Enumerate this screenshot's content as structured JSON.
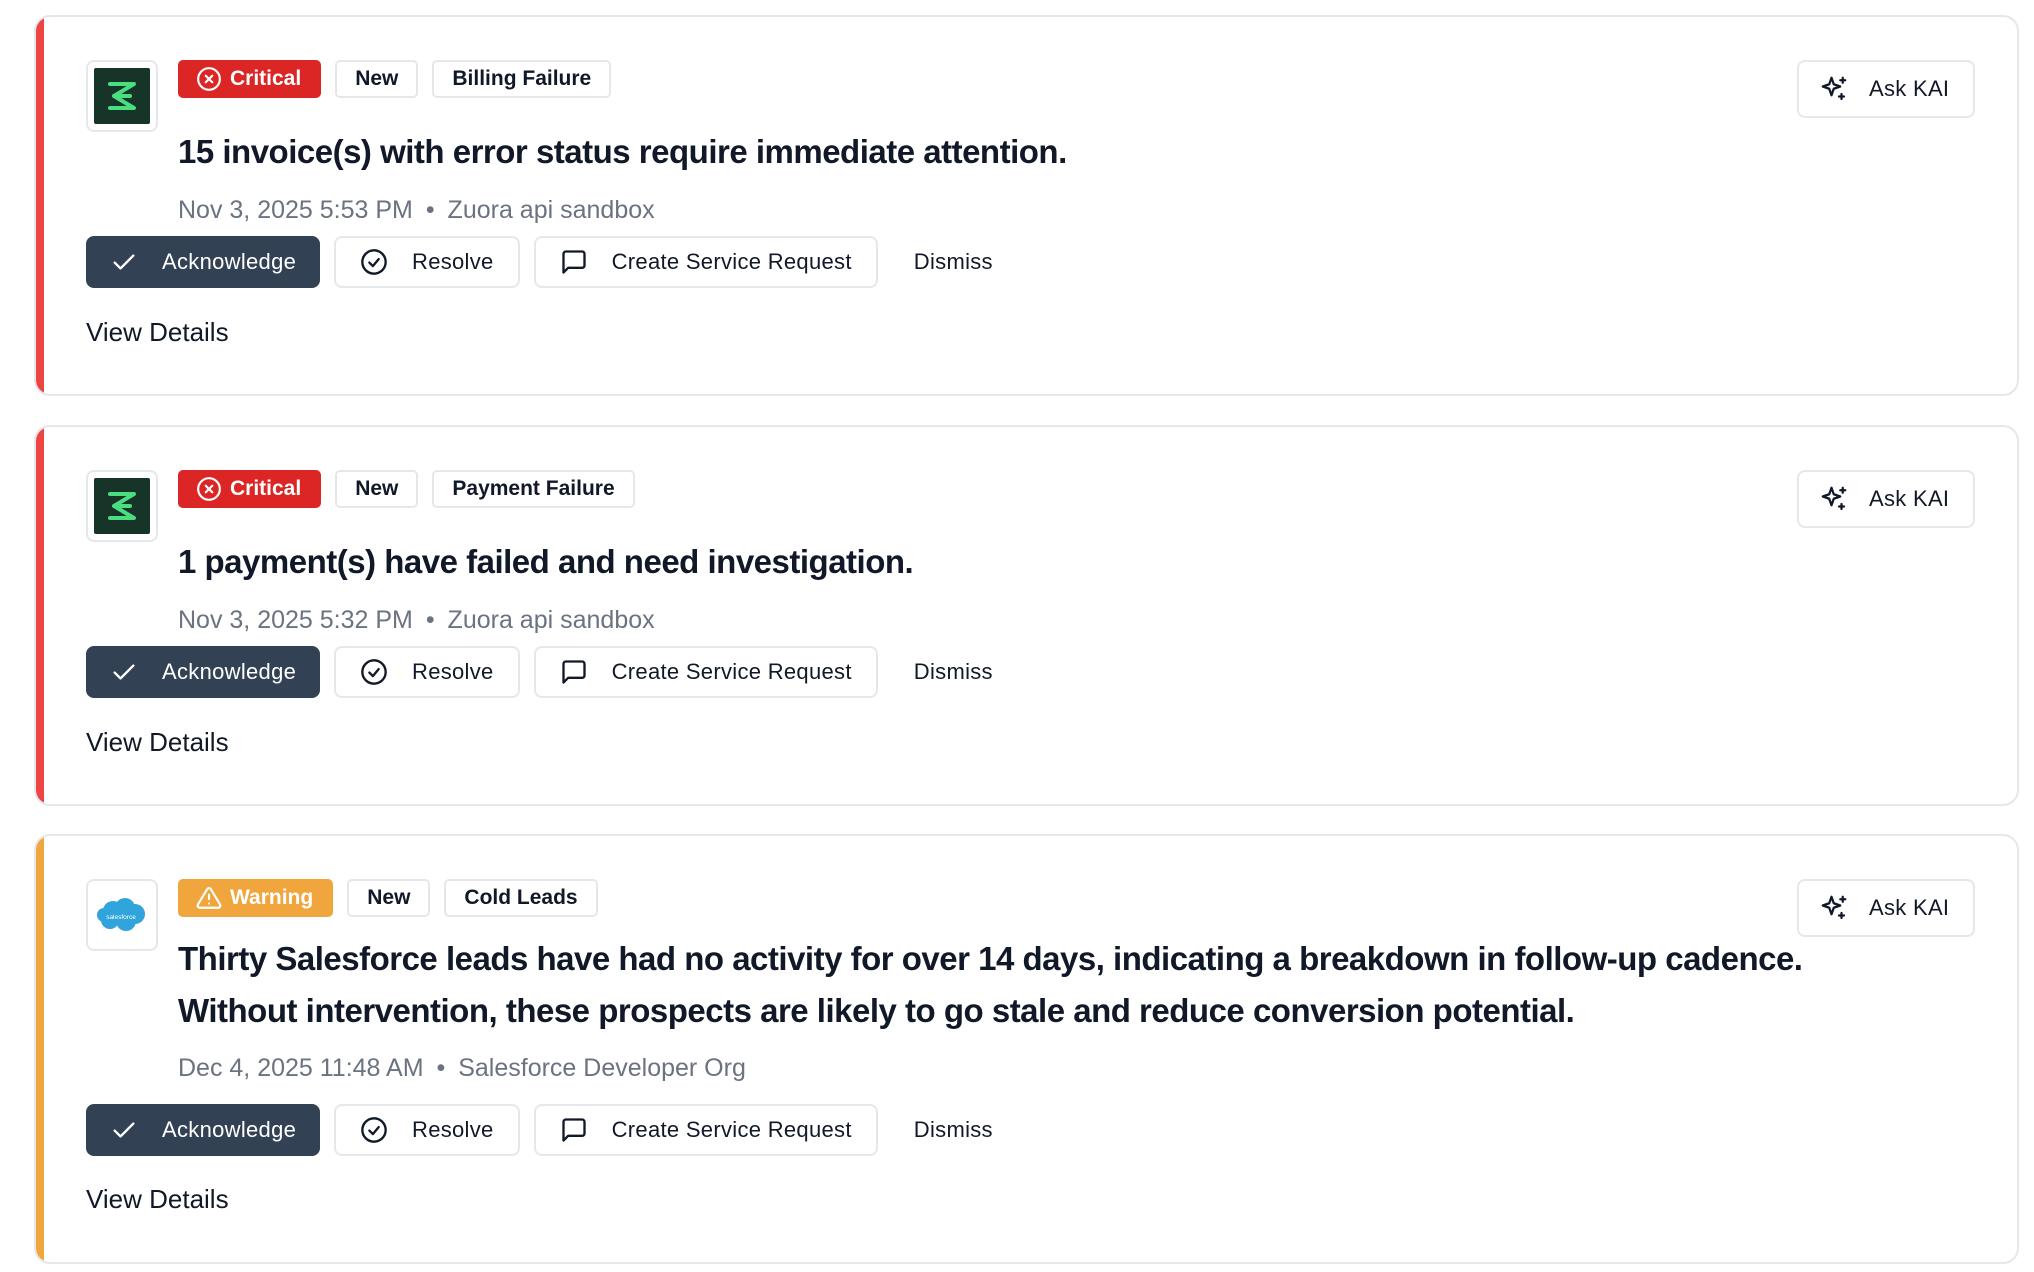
{
  "colors": {
    "critical": "#dc2626",
    "critical_accent": "#ef4444",
    "warning": "#f0a63c",
    "primary_button": "#334155",
    "zuora_logo_bg": "#173428",
    "zuora_logo_fg": "#4ade80",
    "salesforce_logo": "#31a4dc"
  },
  "alerts": [
    {
      "severity": "Critical",
      "severity_icon": "x-circle-icon",
      "status": "New",
      "category": "Billing Failure",
      "logo": "zuora-logo-icon",
      "title": "15 invoice(s) with error status require immediate attention.",
      "timestamp": "Nov 3, 2025 5:53 PM",
      "separator": "•",
      "source": "Zuora api sandbox",
      "actions": {
        "acknowledge": "Acknowledge",
        "resolve": "Resolve",
        "service_request": "Create Service Request",
        "dismiss": "Dismiss"
      },
      "view_details": "View Details",
      "ask": "Ask KAI"
    },
    {
      "severity": "Critical",
      "severity_icon": "x-circle-icon",
      "status": "New",
      "category": "Payment Failure",
      "logo": "zuora-logo-icon",
      "title": "1 payment(s) have failed and need investigation.",
      "timestamp": "Nov 3, 2025 5:32 PM",
      "separator": "•",
      "source": "Zuora api sandbox",
      "actions": {
        "acknowledge": "Acknowledge",
        "resolve": "Resolve",
        "service_request": "Create Service Request",
        "dismiss": "Dismiss"
      },
      "view_details": "View Details",
      "ask": "Ask KAI"
    },
    {
      "severity": "Warning",
      "severity_icon": "warning-triangle-icon",
      "status": "New",
      "category": "Cold Leads",
      "logo": "salesforce-logo-icon",
      "logo_text": "salesforce",
      "title_line1": "Thirty Salesforce leads have had no activity for over 14 days, indicating a breakdown in follow-up cadence.",
      "title_line2": "Without intervention, these prospects are likely to go stale and reduce conversion potential.",
      "timestamp": "Dec 4, 2025 11:48 AM",
      "separator": "•",
      "source": "Salesforce Developer Org",
      "actions": {
        "acknowledge": "Acknowledge",
        "resolve": "Resolve",
        "service_request": "Create Service Request",
        "dismiss": "Dismiss"
      },
      "view_details": "View Details",
      "ask": "Ask KAI"
    }
  ]
}
